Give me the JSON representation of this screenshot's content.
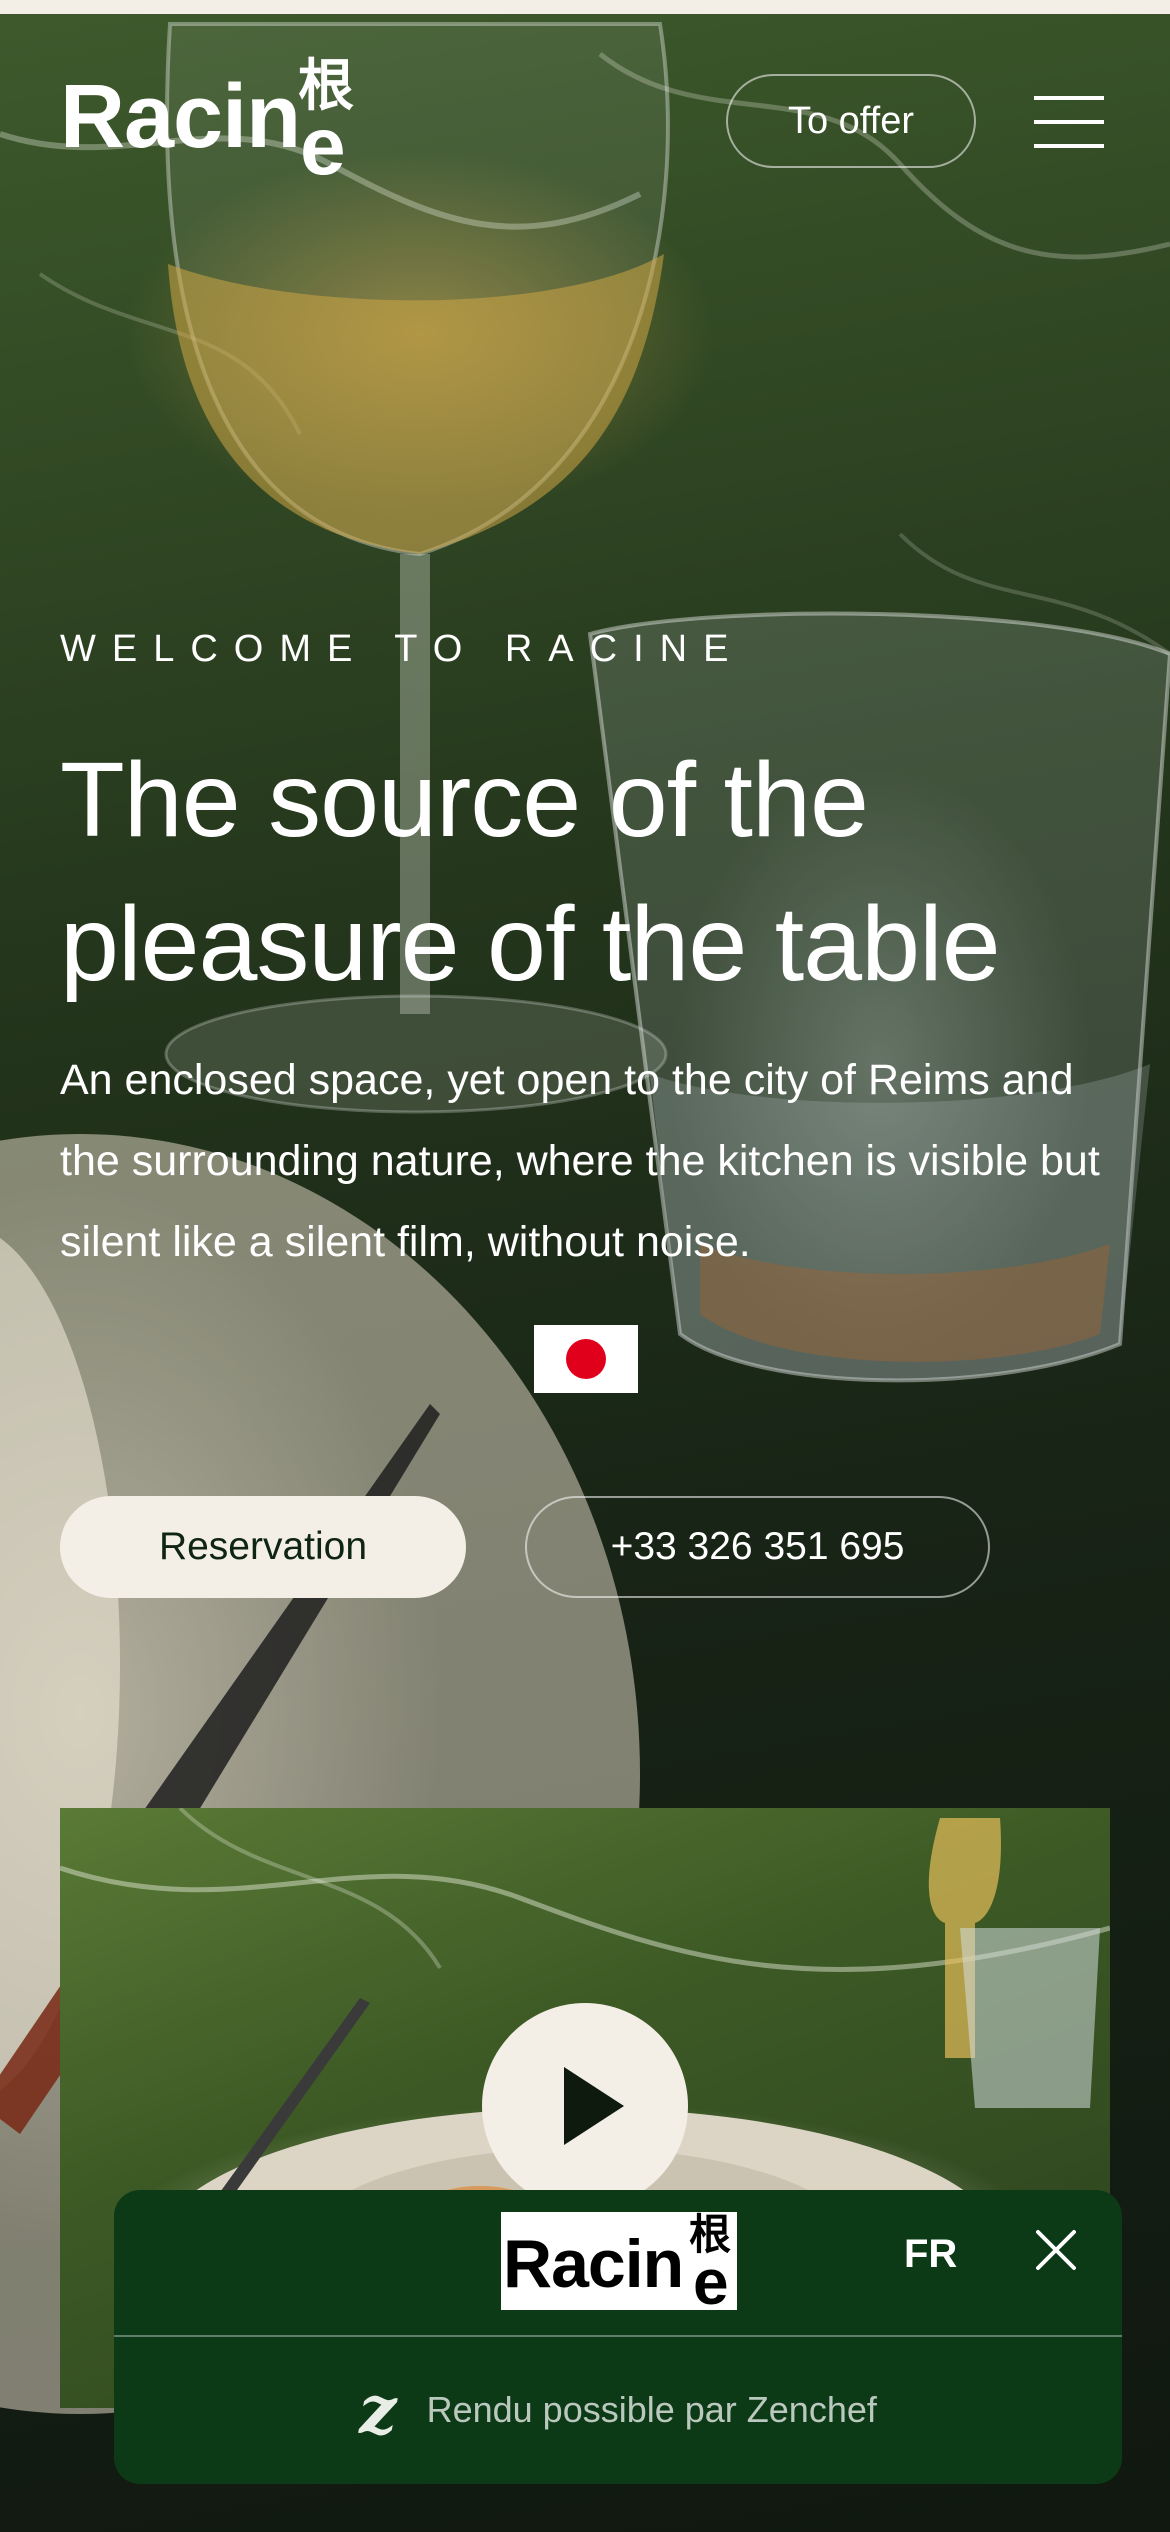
{
  "header": {
    "logo_text": "Racin",
    "logo_kanji": "根",
    "logo_e": "e",
    "offer_label": "To offer",
    "menu_icon": "hamburger-menu-icon"
  },
  "hero": {
    "eyebrow": "WELCOME TO RACINE",
    "headline": "The source of the pleasure of the table",
    "intro": "An enclosed space, yet open to the city of Reims and the surrounding nature, where the kitchen is visible but silent like a silent film, without noise.",
    "flag_icon": "japan-flag-icon",
    "reservation_label": "Reservation",
    "phone_label": "+33 326 351 695"
  },
  "video": {
    "play_icon": "play-icon"
  },
  "booking_widget": {
    "logo_text": "Racin",
    "logo_kanji": "根",
    "logo_e": "e",
    "language": "FR",
    "close_icon": "close-icon",
    "brand_icon": "zenchef-z-icon",
    "brand_glyph": "z",
    "powered_by": "Rendu possible par Zenchef"
  },
  "colors": {
    "cream": "#f3efe6",
    "widget_green": "#0c3a16",
    "button_text": "#0f2411",
    "flag_red": "#e0001b"
  }
}
